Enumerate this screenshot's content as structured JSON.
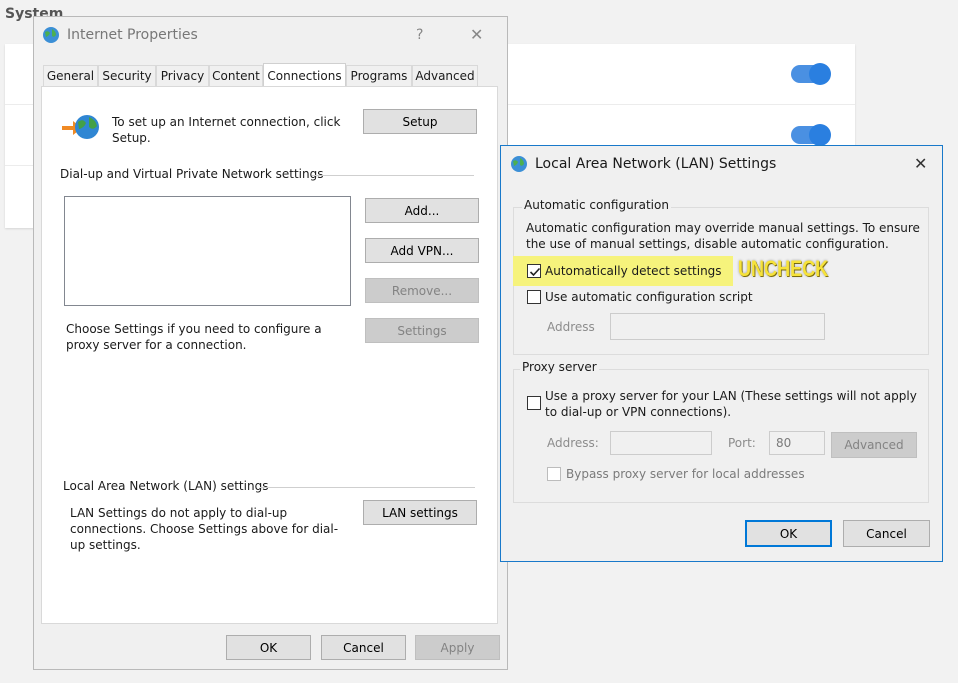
{
  "background": {
    "title": "System"
  },
  "internet_properties": {
    "title": "Internet Properties",
    "help_glyph": "?",
    "close_glyph": "✕",
    "tabs": [
      {
        "label": "General",
        "active": false
      },
      {
        "label": "Security",
        "active": false
      },
      {
        "label": "Privacy",
        "active": false
      },
      {
        "label": "Content",
        "active": false
      },
      {
        "label": "Connections",
        "active": true
      },
      {
        "label": "Programs",
        "active": false
      },
      {
        "label": "Advanced",
        "active": false
      }
    ],
    "setup_text": "To set up an Internet connection, click Setup.",
    "setup_button": "Setup",
    "dialup_heading": "Dial-up and Virtual Private Network settings",
    "add_button": "Add...",
    "add_vpn_button": "Add VPN...",
    "remove_button": "Remove...",
    "settings_button": "Settings",
    "proxy_hint": "Choose Settings if you need to configure a proxy server for a connection.",
    "lan_heading": "Local Area Network (LAN) settings",
    "lan_text": "LAN Settings do not apply to dial-up connections. Choose Settings above for dial-up settings.",
    "lan_button": "LAN settings",
    "ok_button": "OK",
    "cancel_button": "Cancel",
    "apply_button": "Apply"
  },
  "lan_settings": {
    "title": "Local Area Network (LAN) Settings",
    "close_glyph": "✕",
    "auto_config_heading": "Automatic configuration",
    "auto_config_text": "Automatic configuration may override manual settings.  To ensure the use of manual settings, disable automatic configuration.",
    "auto_detect_label": "Automatically detect settings",
    "auto_detect_checked": true,
    "auto_script_label": "Use automatic configuration script",
    "auto_script_checked": false,
    "address_label": "Address",
    "address_value": "",
    "proxy_heading": "Proxy server",
    "use_proxy_label": "Use a proxy server for your LAN (These settings will not apply to dial-up or VPN connections).",
    "use_proxy_checked": false,
    "proxy_address_label": "Address:",
    "proxy_address_value": "",
    "port_label": "Port:",
    "port_value": "80",
    "advanced_button": "Advanced",
    "bypass_label": "Bypass proxy server for local addresses",
    "bypass_checked": false,
    "ok_button": "OK",
    "cancel_button": "Cancel"
  },
  "annotation": {
    "text": "UNCHECK",
    "color": "#f6e23a",
    "highlight_color": "#f6f37c"
  },
  "colors": {
    "accent": "#0078d7",
    "toggle": "#2a7fe0"
  }
}
